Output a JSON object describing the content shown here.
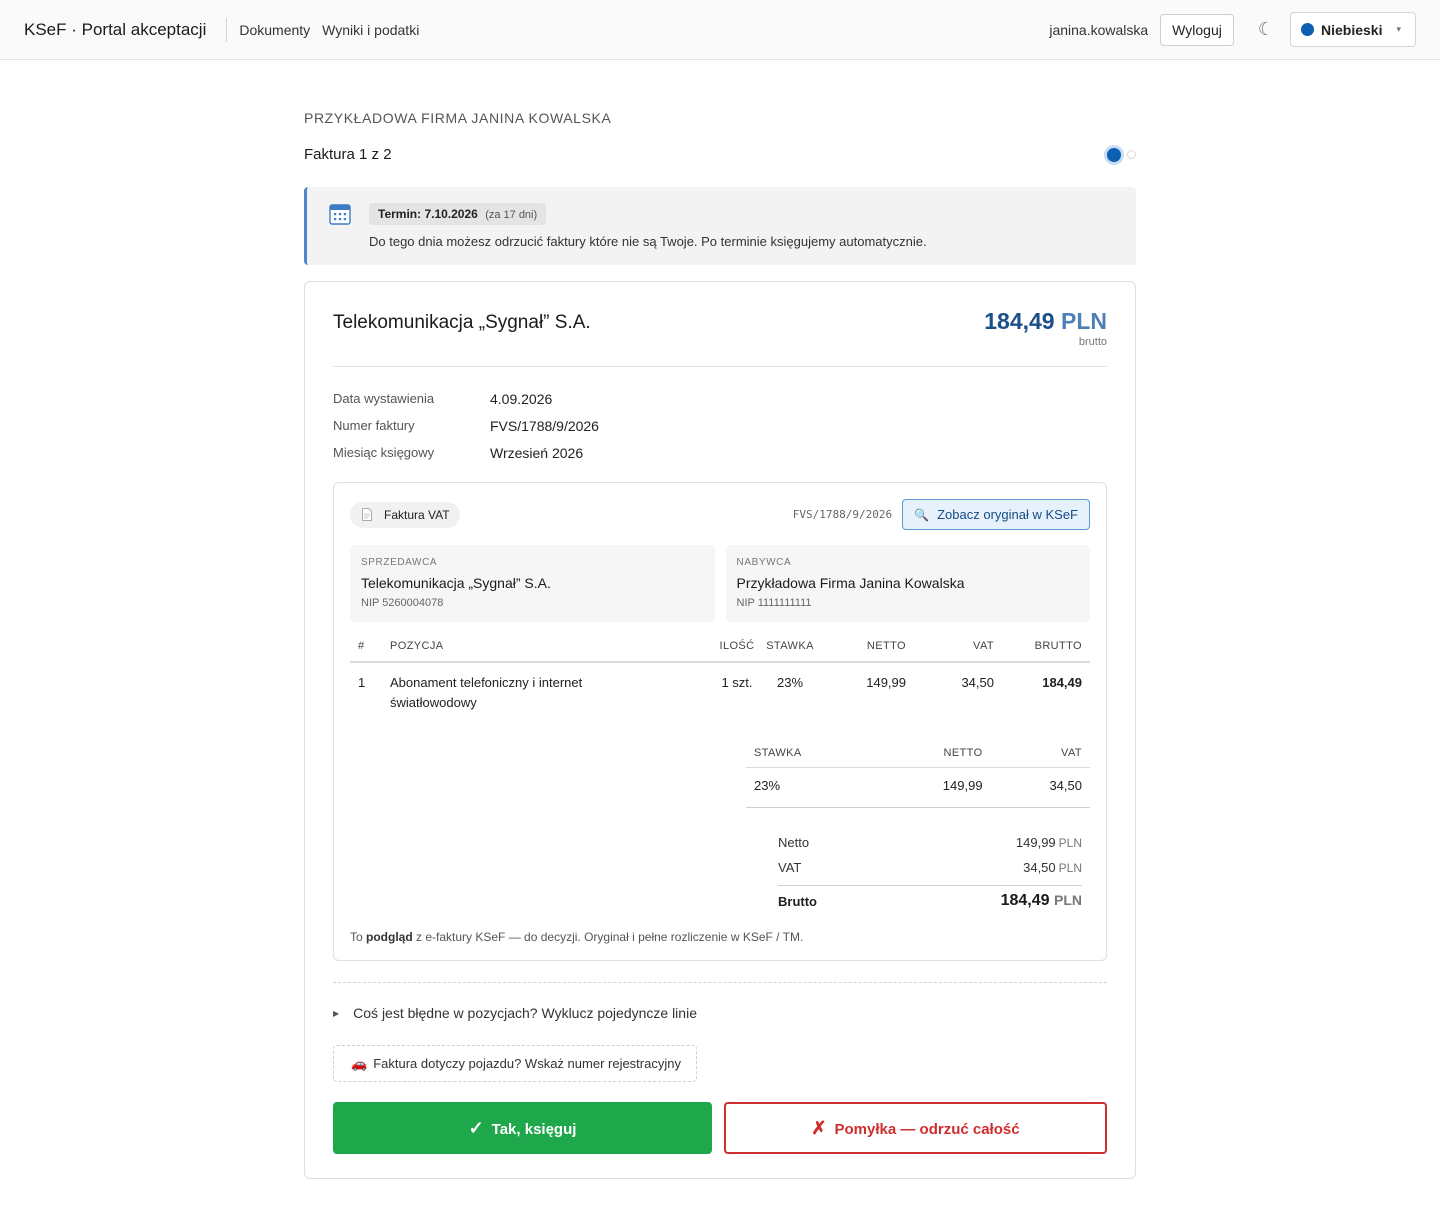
{
  "nav": {
    "brand": "KSeF · Portal akceptacji",
    "links": [
      "Dokumenty",
      "Wyniki i podatki"
    ],
    "user": "janina.kowalska",
    "logout_label": "Wyloguj",
    "theme_icon": "☾",
    "theme_label": "Niebieski",
    "theme_color": "#0d5fb3"
  },
  "header": {
    "company": "PRZYKŁADOWA FIRMA JANINA KOWALSKA",
    "progress": "Faktura 1 z 2",
    "current_index": 1,
    "total": 2
  },
  "deadline": {
    "label": "Termin: 7.10.2026",
    "remaining": "(za 17 dni)",
    "text": "Do tego dnia możesz odrzucić faktury które nie są Twoje. Po terminie księgujemy automatycznie."
  },
  "invoice": {
    "seller_title": "Telekomunikacja „Sygnał” S.A.",
    "amount": "184,49",
    "currency": "PLN",
    "amount_sub": "brutto",
    "meta": [
      {
        "key": "Data wystawienia",
        "value": "4.09.2026"
      },
      {
        "key": "Numer faktury",
        "value": "FVS/1788/9/2026"
      },
      {
        "key": "Miesiąc księgowy",
        "value": "Wrzesień 2026"
      }
    ]
  },
  "document": {
    "type_label": "Faktura VAT",
    "number": "FVS/1788/9/2026",
    "ksef_button": "Zobacz oryginał w KSeF",
    "seller": {
      "role": "SPRZEDAWCA",
      "name": "Telekomunikacja „Sygnał” S.A.",
      "nip": "NIP 5260004078"
    },
    "buyer": {
      "role": "NABYWCA",
      "name": "Przykładowa Firma Janina Kowalska",
      "nip": "NIP 1111111111"
    },
    "items_headers": [
      "#",
      "POZYCJA",
      "ILOŚĆ",
      "STAWKA",
      "NETTO",
      "VAT",
      "BRUTTO"
    ],
    "items": [
      {
        "no": "1",
        "name": "Abonament telefoniczny i internet światłowodowy",
        "qty": "1 szt.",
        "rate": "23%",
        "net": "149,99",
        "vat": "34,50",
        "gross": "184,49"
      }
    ],
    "vat_headers": [
      "STAWKA",
      "NETTO",
      "VAT"
    ],
    "vat_rows": [
      {
        "rate": "23%",
        "net": "149,99",
        "vat": "34,50"
      }
    ],
    "totals": {
      "net_label": "Netto",
      "net": "149,99",
      "vat_label": "VAT",
      "vat": "34,50",
      "gross_label": "Brutto",
      "gross": "184,49",
      "unit": "PLN"
    },
    "note_prefix": "To ",
    "note_bold": "podgląd",
    "note_suffix": " z e-faktury KSeF — do decyzji. Oryginał i pełne rozliczenie w KSeF / TM."
  },
  "actions": {
    "exclude_lines": "Coś jest błędne w pozycjach? Wyklucz pojedyncze linie",
    "vehicle": "Faktura dotyczy pojazdu? Wskaż numer rejestracyjny",
    "accept_label": "Tak, księguj",
    "reject_label": "Pomyłka — odrzuć całość",
    "accept_color": "#1ea84b",
    "reject_color": "#cf2e2e"
  }
}
